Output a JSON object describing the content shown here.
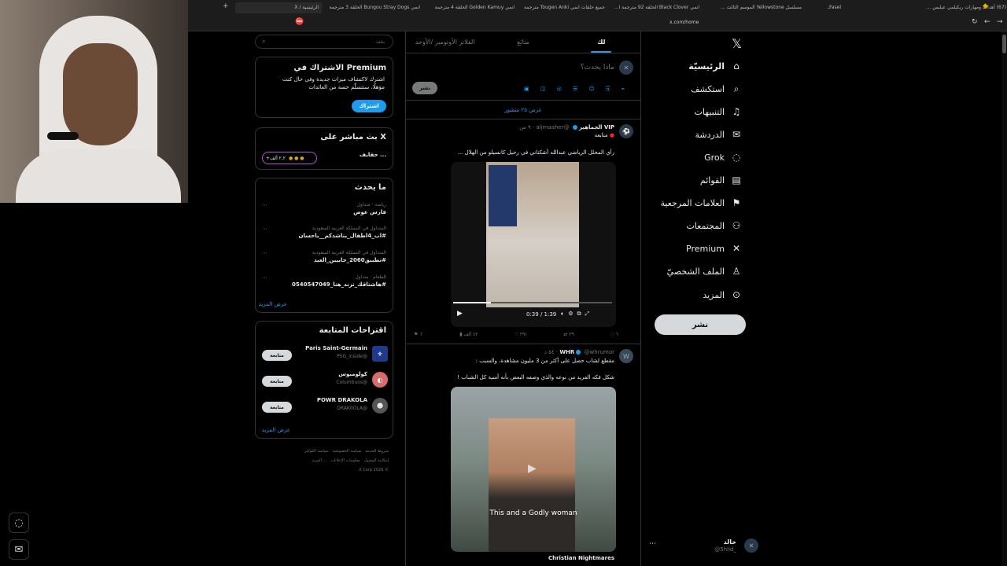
{
  "browser": {
    "tabs": [
      "(67) أهداف ومهارات ريكيلمي عيلبس ...",
      "Faselـ",
      "مسلسل Yellowstone الموسم الثالث ...",
      "انمي Black Clover الحلقة 92 مترجمة ا...",
      "جميع حلقات انمي Tougen Anki مترجمة",
      "انمي Golden Kamuy الحلقة 4 مترجمة",
      "انمي Bungou Stray Dogs الحلقة 3 مترجمة",
      "الرئيسية / X"
    ],
    "url": "x.com/home"
  },
  "nav": {
    "items": [
      {
        "label": "الرئيسيّة",
        "icon": "home-icon",
        "glyph": "⌂"
      },
      {
        "label": "استكشف",
        "icon": "search-icon",
        "glyph": "⌕"
      },
      {
        "label": "التنبيهات",
        "icon": "bell-icon",
        "glyph": "🔔︎"
      },
      {
        "label": "الدردشة",
        "icon": "mail-icon",
        "glyph": "✉"
      },
      {
        "label": "Grok",
        "icon": "grok-icon",
        "glyph": "◌"
      },
      {
        "label": "القوائم",
        "icon": "list-icon",
        "glyph": "▤"
      },
      {
        "label": "العلامات المرجعية",
        "icon": "bookmark-icon",
        "glyph": "⚑"
      },
      {
        "label": "المجتمعات",
        "icon": "communities-icon",
        "glyph": "⚇"
      },
      {
        "label": "Premium",
        "icon": "x-icon",
        "glyph": "✕"
      },
      {
        "label": "الملف الشخصيّ",
        "icon": "profile-icon",
        "glyph": "♙"
      },
      {
        "label": "المزيد",
        "icon": "more-icon",
        "glyph": "⋯"
      }
    ],
    "post_button": "نشر",
    "profile_name": "خالد",
    "profile_handle": "@5hlid_"
  },
  "feed": {
    "tabs": [
      "لك",
      "متابَع",
      "الفلاتر الأوتومير /الأوحد"
    ],
    "compose_placeholder": "ماذا يحدث؟",
    "post_button": "نشر",
    "show_more": "عرض ٢٥ منشور",
    "tweets": [
      {
        "name": "VIP الجماهير",
        "handle": "@aljmaaher",
        "time": "٩ س",
        "follow": "متابعة",
        "text": "رأي المحلل الرياضي عبدالله أشكناني في رحيل كانسيلو من الهلال ...",
        "video_time": "0:39 / 1:39",
        "actions": {
          "reply": "٦",
          "repost": "٣٩",
          "like": "٢٩١",
          "views": "٤٢ ألف"
        }
      },
      {
        "name": "WHR",
        "handle": "@whrumor",
        "time": "٥٤ د",
        "text1": "مقطع لشاب حصل على أكثر من 3 مليون مشاهدة، والسبب :",
        "text2": "شكل فكه الفريد من نوعه والذي وصفه البعض بأنه أمنية كل الشباب !",
        "caption": "This and a Godly woman",
        "source": "Christian Nightmares"
      }
    ]
  },
  "sidebar": {
    "search_placeholder": "بحث",
    "premium": {
      "title": "Premium الاشتراك في",
      "text": "اشترك لاكتشاف ميزات جديدة وفي حال كنت مؤهلًا، ستتسلّم حصة من العائدات",
      "button": "اشتراك"
    },
    "live": {
      "title": "X بث مباشر على",
      "item": "... حقايف",
      "count": "+٢,٢ ألف"
    },
    "trends": {
      "title": "ما يحدث",
      "items": [
        {
          "meta": "رياضة · متداول",
          "name": "فارس عوض"
        },
        {
          "meta": "المتداول في المملكة العربية السعودية",
          "name": "#اب_4اطفال_يناشدكم__باحسان"
        },
        {
          "meta": "المتداول في المملكة العربية السعودية",
          "name": "#تطبيق2060_جابيبن_العيد"
        },
        {
          "meta": "الطعام · متداول",
          "name": "#هاشتاقك_ترند_هنا_0540547049"
        }
      ],
      "show_more": "عرض المزيد"
    },
    "follow": {
      "title": "اقتراحات المتابعة",
      "items": [
        {
          "name": "Paris Saint-Germain",
          "handle": "@PSG_inside",
          "button": "متابعة"
        },
        {
          "name": "كولومبوس",
          "handle": "@Columbuos",
          "button": "متابعة"
        },
        {
          "name": "POWR DRAKOLA",
          "handle": "@DRAK0OLA",
          "button": "متابعة"
        }
      ],
      "show_more": "عرض المزيد"
    },
    "footer": [
      "شروط الخدمة",
      "سياسة الخصوصية",
      "سياسة الكوكيز",
      "إمكانية الوصول",
      "معلومات الإعلانات",
      "... المزيد",
      "© 2026 X Corp."
    ]
  }
}
